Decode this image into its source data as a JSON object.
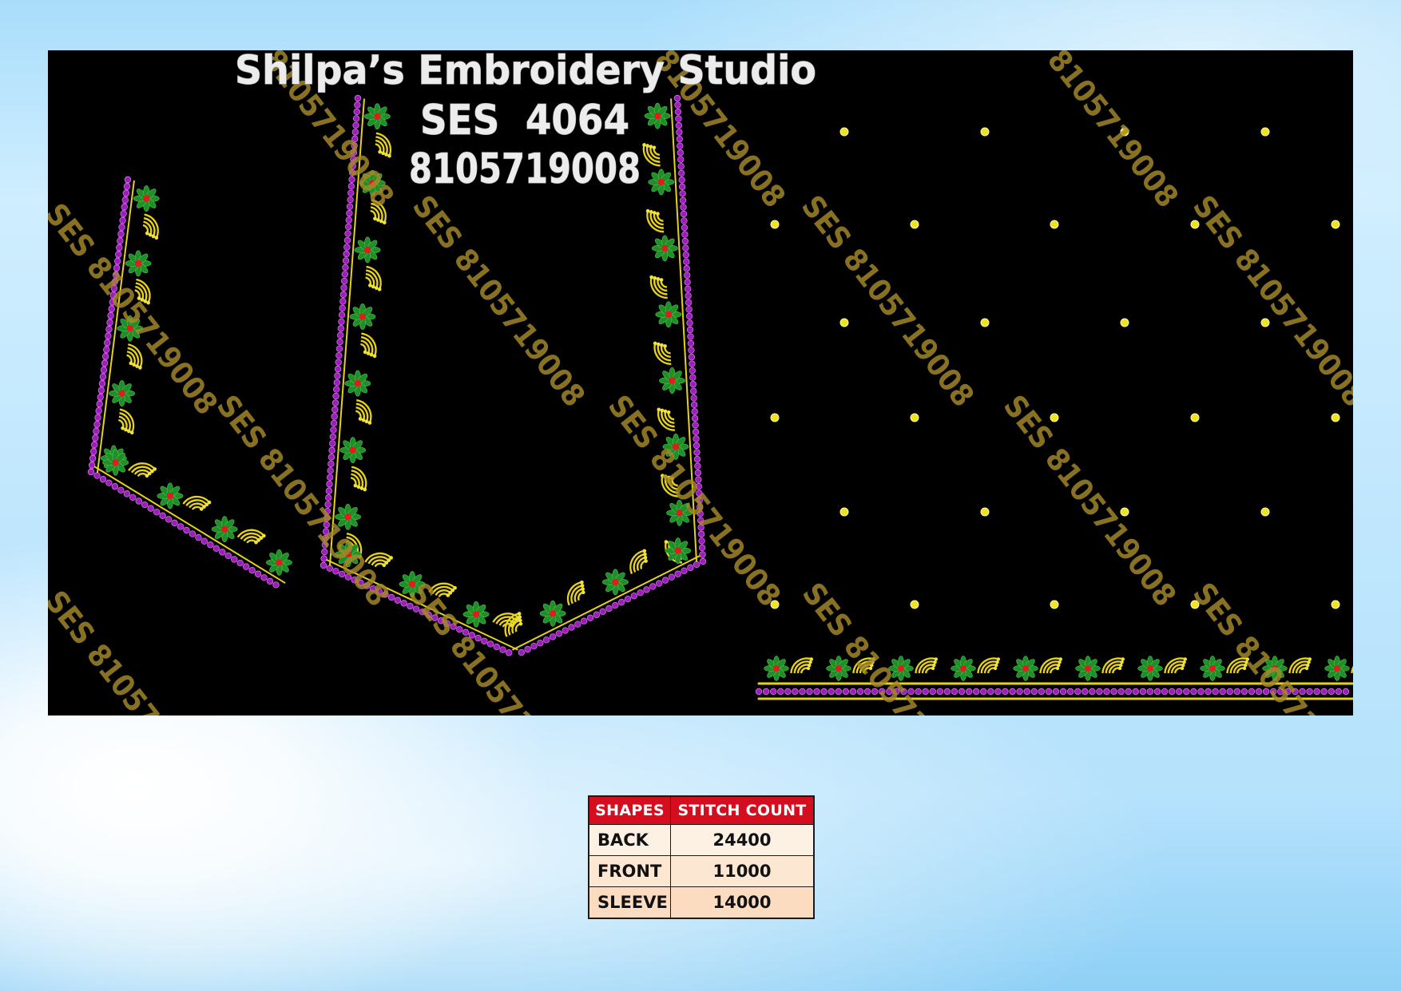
{
  "design": {
    "studio_name": "Shilpa’s Embroidery Studio",
    "design_code": "SES  4064",
    "phone": "8105719008"
  },
  "watermarks": {
    "full": "SES 8105719008",
    "number_only": "8105719008"
  },
  "table": {
    "headers": [
      "SHAPES",
      "STITCH COUNT"
    ],
    "rows": [
      {
        "shape": "BACK",
        "count": "24400"
      },
      {
        "shape": "FRONT",
        "count": "11000"
      },
      {
        "shape": "SLEEVE",
        "count": "14000"
      }
    ]
  },
  "colors": {
    "table_header": "#d40d1f",
    "bead_purple": "#9a1fb8",
    "flower_green": "#1f8f2a",
    "thread_yellow": "#e6d21a",
    "canvas": "#000000"
  }
}
